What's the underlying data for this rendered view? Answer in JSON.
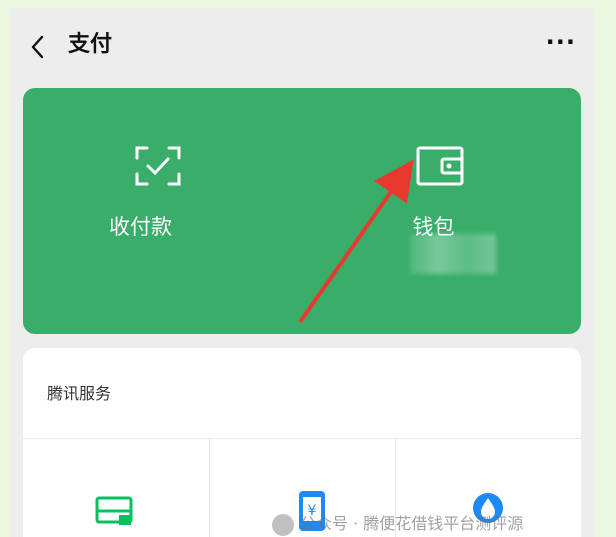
{
  "header": {
    "title": "支付",
    "more_label": "···"
  },
  "pay_card": {
    "tiles": [
      {
        "label": "收付款",
        "icon": "scan-check-icon"
      },
      {
        "label": "钱包",
        "icon": "wallet-icon"
      }
    ]
  },
  "services": {
    "section_title": "腾讯服务",
    "items": [
      {
        "icon": "card-icon"
      },
      {
        "icon": "phone-recharge-icon"
      },
      {
        "icon": "water-drop-icon"
      }
    ]
  },
  "watermark": {
    "text": "公众号 · 腾便花借钱平台测评源"
  },
  "colors": {
    "page_bg": "#eaf6dd",
    "card_green": "#39ae6b",
    "arrow_red": "#e8392f",
    "service_green": "#07c160",
    "service_blue": "#1d8af5"
  }
}
